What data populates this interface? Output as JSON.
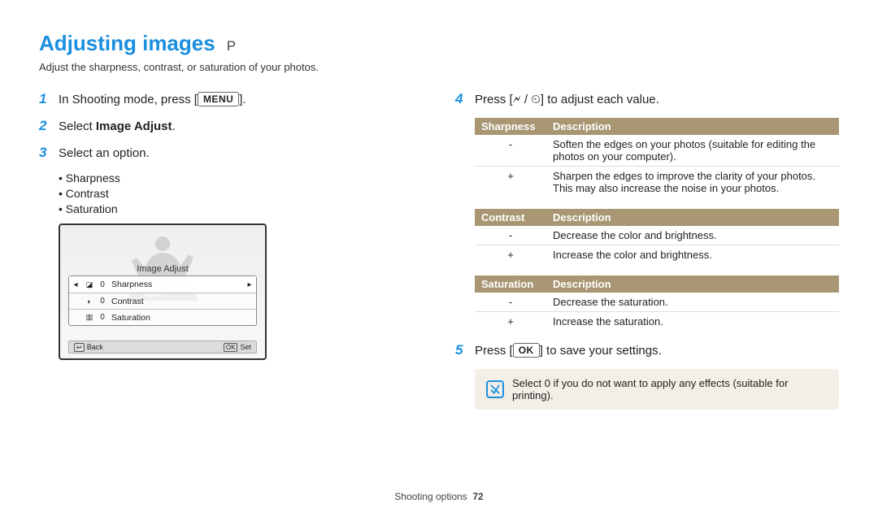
{
  "header": {
    "title": "Adjusting images",
    "mode": "P",
    "subtitle": "Adjust the sharpness, contrast, or saturation of your photos."
  },
  "buttons": {
    "menu": "MENU",
    "ok": "OK"
  },
  "left": {
    "step1_a": "In Shooting mode, press [",
    "step1_b": "].",
    "step2_a": "Select ",
    "step2_bold": "Image Adjust",
    "step2_b": ".",
    "step3": "Select an option.",
    "sublist": [
      "Sharpness",
      "Contrast",
      "Saturation"
    ]
  },
  "lcd": {
    "title": "Image Adjust",
    "rows": [
      {
        "icon": "◪",
        "val": "0",
        "label": "Sharpness",
        "arrows": true
      },
      {
        "icon": "◐",
        "val": "0",
        "label": "Contrast",
        "arrows": false
      },
      {
        "icon": "▥",
        "val": "0",
        "label": "Saturation",
        "arrows": false
      }
    ],
    "back": "Back",
    "set": "Set",
    "back_key": "↩",
    "set_key": "OK"
  },
  "right": {
    "step4_a": "Press [",
    "step4_b": "] to adjust each value.",
    "adjust_icons": "🗲 / ⏲",
    "step5_a": "Press [",
    "step5_b": "] to save your settings."
  },
  "tables": {
    "sharpness": {
      "h1": "Sharpness",
      "h2": "Description",
      "rows": [
        {
          "k": "-",
          "v": "Soften the edges on your photos (suitable for editing the photos on your computer)."
        },
        {
          "k": "+",
          "v": "Sharpen the edges to improve the clarity of your photos. This may also increase the noise in your photos."
        }
      ]
    },
    "contrast": {
      "h1": "Contrast",
      "h2": "Description",
      "rows": [
        {
          "k": "-",
          "v": "Decrease the color and brightness."
        },
        {
          "k": "+",
          "v": "Increase the color and brightness."
        }
      ]
    },
    "saturation": {
      "h1": "Saturation",
      "h2": "Description",
      "rows": [
        {
          "k": "-",
          "v": "Decrease the saturation."
        },
        {
          "k": "+",
          "v": "Increase the saturation."
        }
      ]
    }
  },
  "note": "Select 0 if you do not want to apply any effects (suitable for printing).",
  "footer": {
    "section": "Shooting options",
    "page": "72"
  }
}
